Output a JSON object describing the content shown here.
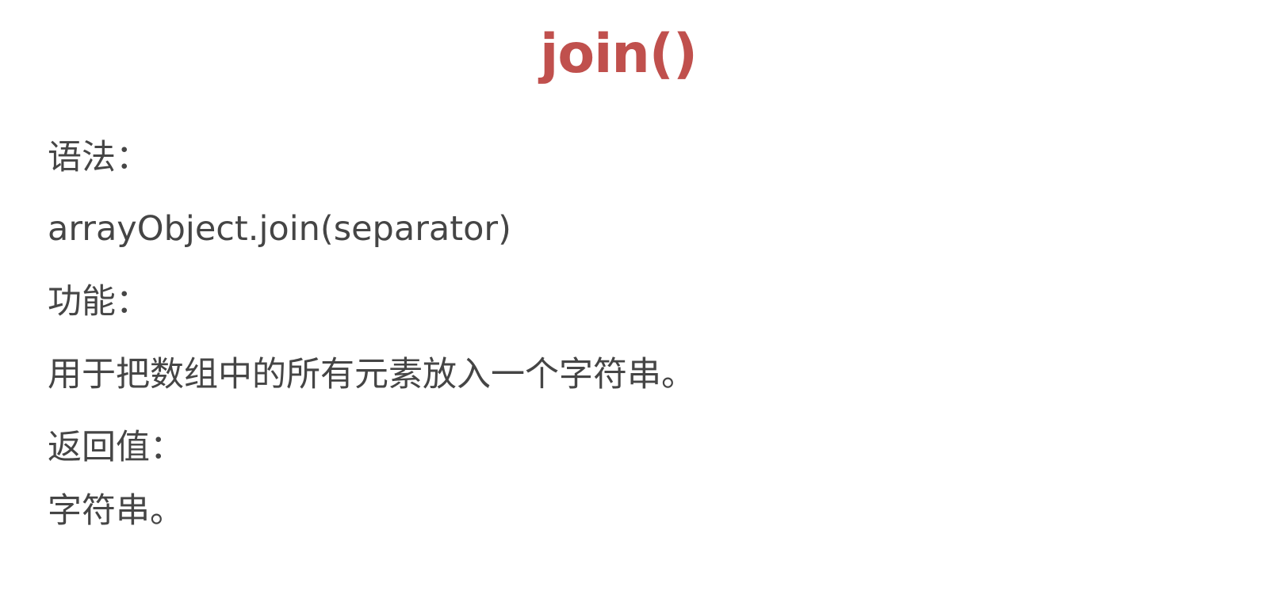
{
  "slide": {
    "title": "join()",
    "syntax_label": "语法：",
    "syntax_code": "arrayObject.join(separator)",
    "function_label": "功能：",
    "function_text": "用于把数组中的所有元素放入一个字符串。",
    "return_label": "返回值：",
    "return_text": "字符串。"
  },
  "colors": {
    "title": "#c0504d",
    "body_text": "#454545",
    "background": "#ffffff"
  }
}
